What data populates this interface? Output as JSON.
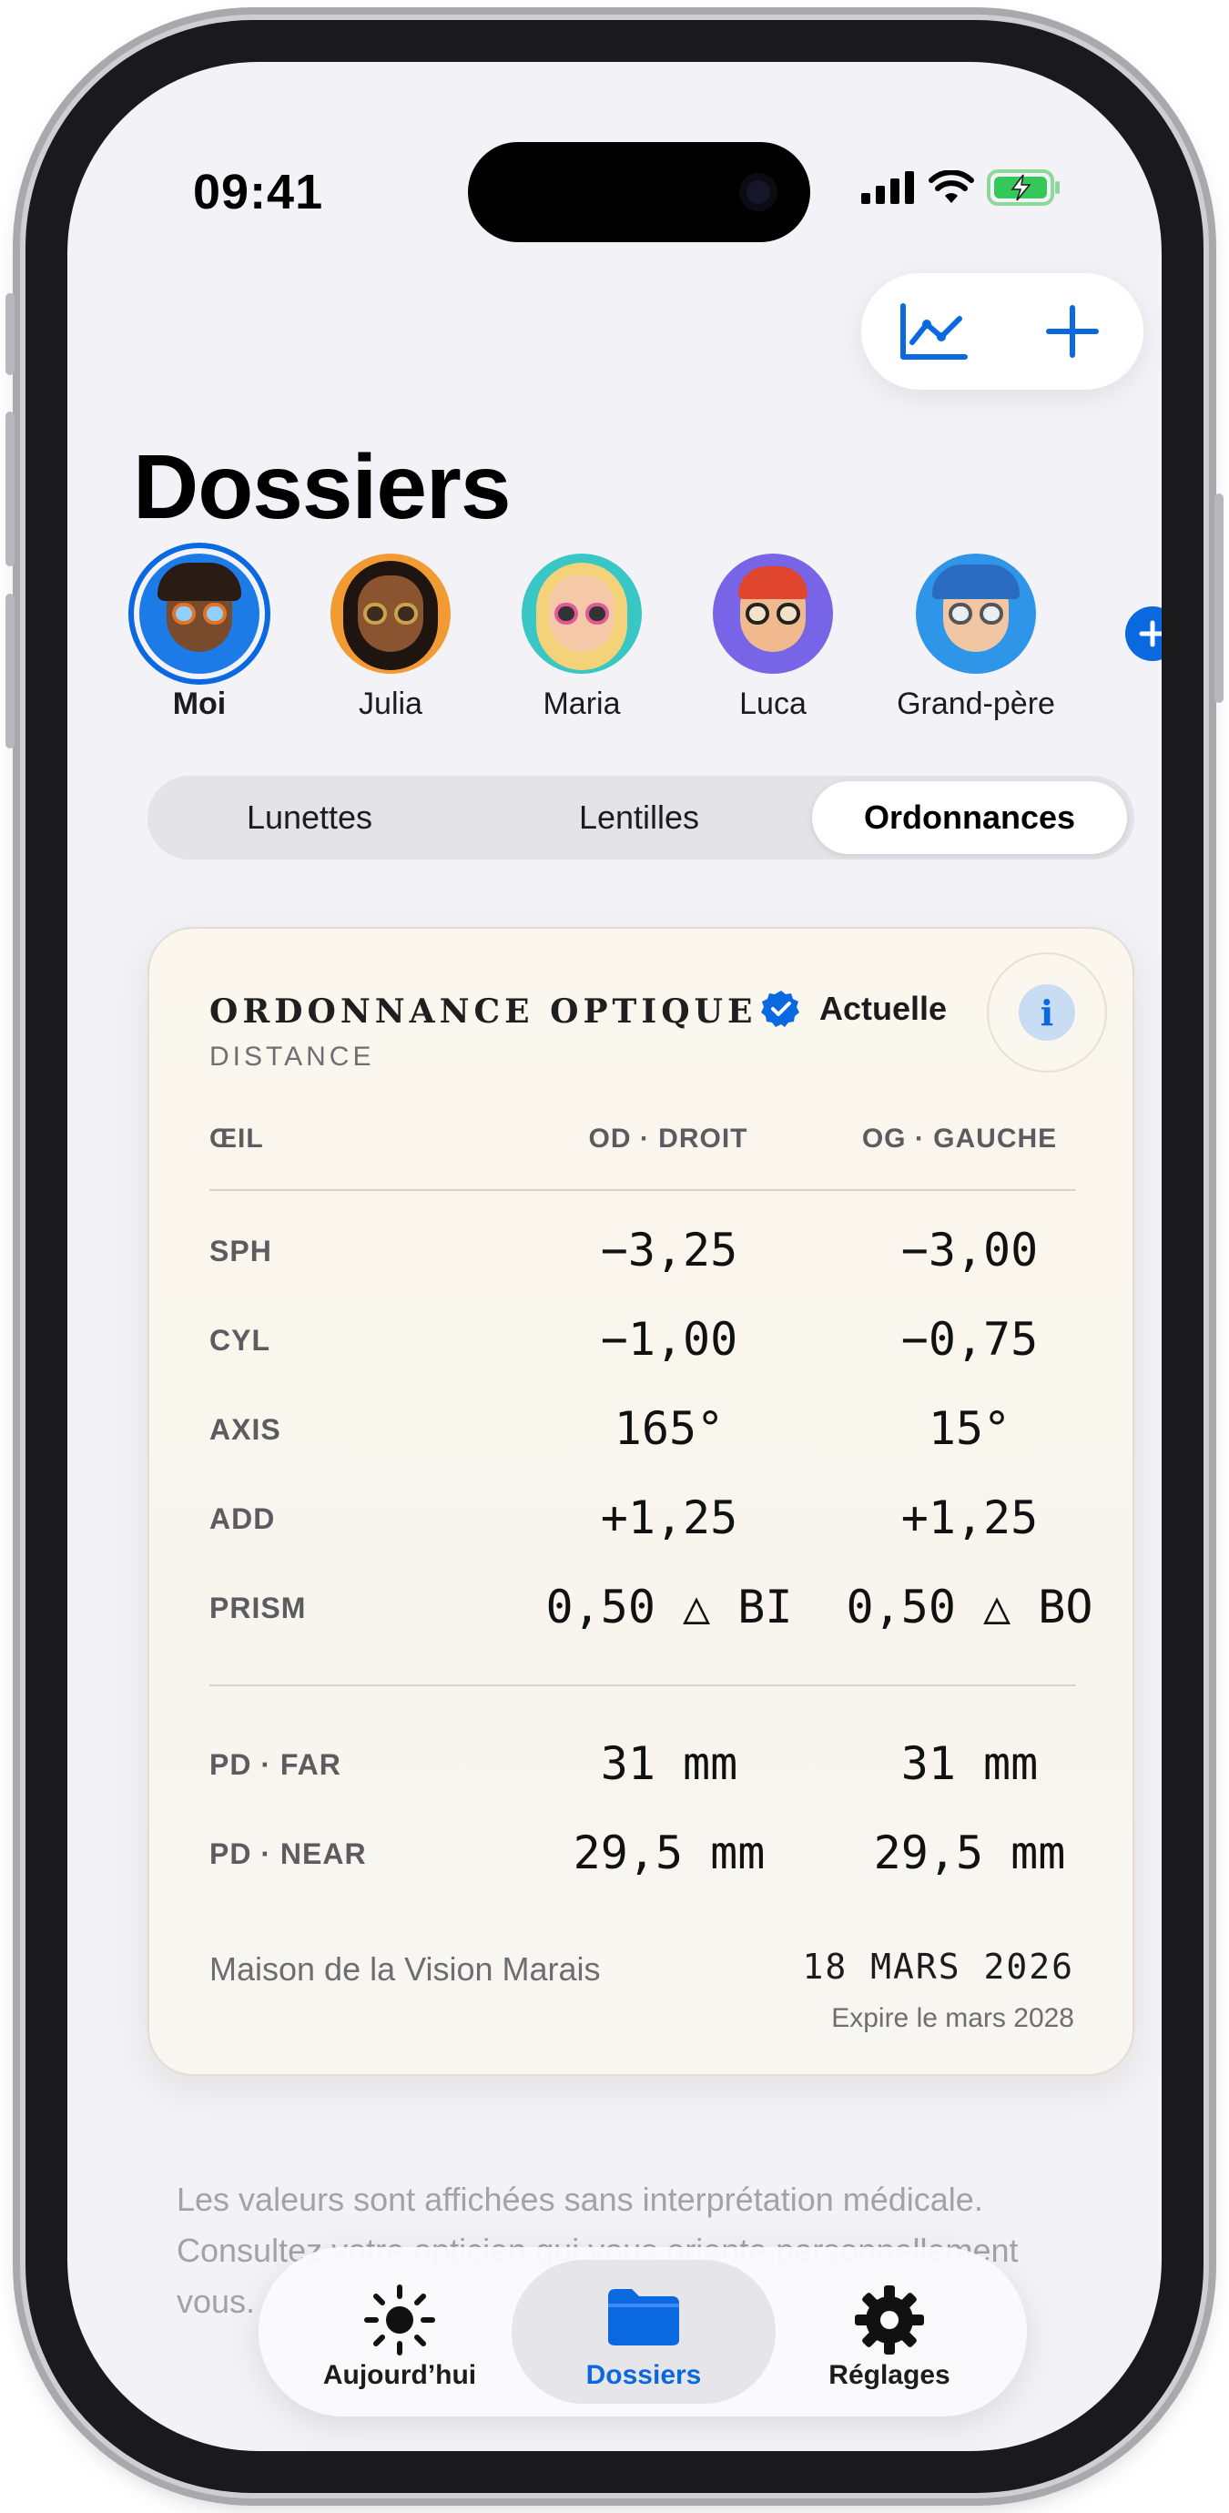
{
  "status": {
    "time": "09:41"
  },
  "page": {
    "title": "Dossiers"
  },
  "profiles": [
    {
      "name": "Moi",
      "selected": true
    },
    {
      "name": "Julia",
      "selected": false
    },
    {
      "name": "Maria",
      "selected": false
    },
    {
      "name": "Luca",
      "selected": false
    },
    {
      "name": "Grand-père",
      "selected": false
    }
  ],
  "segments": [
    {
      "label": "Lunettes",
      "active": false
    },
    {
      "label": "Lentilles",
      "active": false
    },
    {
      "label": "Ordonnances",
      "active": true
    }
  ],
  "prescription": {
    "title": "ORDONNANCE OPTIQUE",
    "subtitle": "DISTANCE",
    "badge": "Actuelle",
    "columns": {
      "eye": "ŒIL",
      "right": "OD · DROIT",
      "left": "OG · GAUCHE"
    },
    "rows": [
      {
        "label": "SPH",
        "right": "−3,25",
        "left": "−3,00"
      },
      {
        "label": "CYL",
        "right": "−1,00",
        "left": "−0,75"
      },
      {
        "label": "AXIS",
        "right": "165°",
        "left": "15°"
      },
      {
        "label": "ADD",
        "right": "+1,25",
        "left": "+1,25"
      },
      {
        "label": "PRISM",
        "right": "0,50 △ BI",
        "left": "0,50 △ BO"
      }
    ],
    "pd_rows": [
      {
        "label": "PD · FAR",
        "right": "31 mm",
        "left": "31 mm"
      },
      {
        "label": "PD · NEAR",
        "right": "29,5 mm",
        "left": "29,5 mm"
      }
    ],
    "clinic": "Maison de la Vision Marais",
    "date": "18 MARS 2026",
    "expiry": "Expire le mars 2028"
  },
  "footnote": "Les valeurs sont affichées sans interprétation médicale. Consultez votre opticien qui vous oriente personnellement vous.",
  "tabs": [
    {
      "label": "Aujourd’hui",
      "icon": "sun-icon",
      "active": false
    },
    {
      "label": "Dossiers",
      "icon": "folder-icon",
      "active": true
    },
    {
      "label": "Réglages",
      "icon": "gear-icon",
      "active": false
    }
  ],
  "colors": {
    "accent": "#0a68e0",
    "card": "#f9f6ee",
    "background": "#f2f2f7"
  }
}
